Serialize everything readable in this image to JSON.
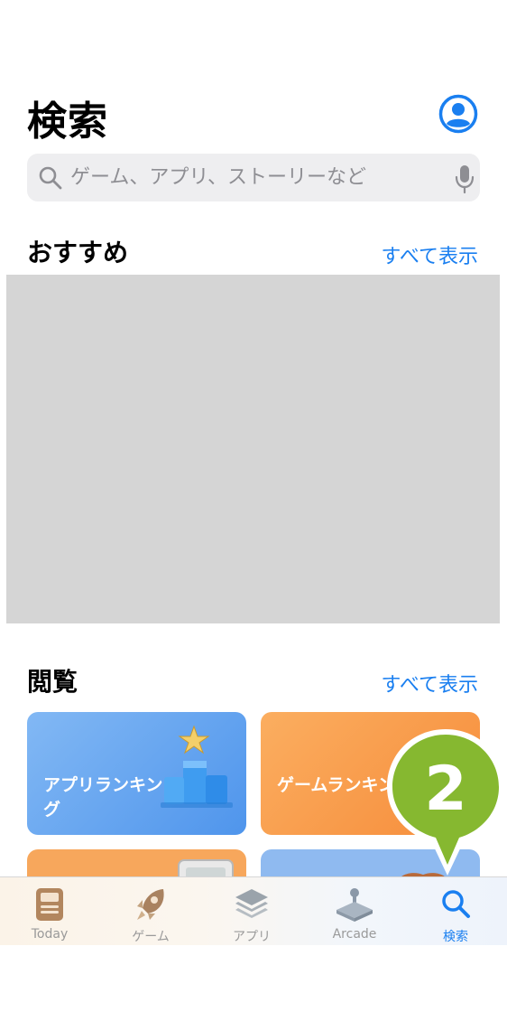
{
  "header": {
    "title": "検索"
  },
  "search": {
    "placeholder": "ゲーム、アプリ、ストーリーなど"
  },
  "recommended": {
    "title": "おすすめ",
    "see_all": "すべて表示"
  },
  "browse": {
    "title": "閲覧",
    "see_all": "すべて表示",
    "cards": [
      {
        "label": "アプリランキング",
        "color": "#64a6f0"
      },
      {
        "label": "ゲームランキング",
        "color": "#f99a4a"
      },
      {
        "label": "",
        "color": "#f7a75c"
      },
      {
        "label": "",
        "color": "#8fbaf0"
      }
    ]
  },
  "tabbar": {
    "items": [
      {
        "label": "Today",
        "icon": "today-icon"
      },
      {
        "label": "ゲーム",
        "icon": "rocket-icon"
      },
      {
        "label": "アプリ",
        "icon": "layers-icon"
      },
      {
        "label": "Arcade",
        "icon": "joystick-icon"
      },
      {
        "label": "検索",
        "icon": "search-icon"
      }
    ],
    "active_index": 4
  },
  "annotation": {
    "step_number": "2",
    "color": "#86b830"
  },
  "colors": {
    "accent": "#1a7ff0",
    "placeholder_banner": "#d5d5d5"
  }
}
